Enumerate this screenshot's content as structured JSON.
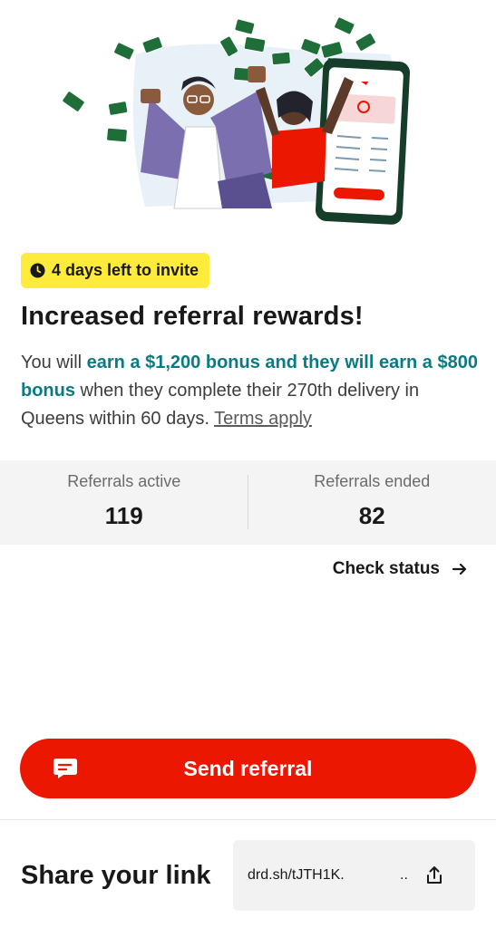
{
  "banner": {
    "days_left": "4 days left to invite"
  },
  "headline": "Increased referral rewards!",
  "description": {
    "part1": "You will ",
    "highlight": "earn a $1,200 bonus and they will earn a $800 bonus",
    "part2": " when they complete their 270th delivery in Queens within 60 days. ",
    "terms": "Terms apply"
  },
  "stats": {
    "active_label": "Referrals active",
    "active_value": "119",
    "ended_label": "Referrals ended",
    "ended_value": "82"
  },
  "check_status": "Check status",
  "send_button": "Send referral",
  "share": {
    "title": "Share your link",
    "link": "drd.sh/tJTH1K.",
    "dots": ".."
  },
  "colors": {
    "accent": "#eb1700",
    "highlight_text": "#0a7b84",
    "badge": "#ffeb3b",
    "money": "#1f6e3a"
  }
}
